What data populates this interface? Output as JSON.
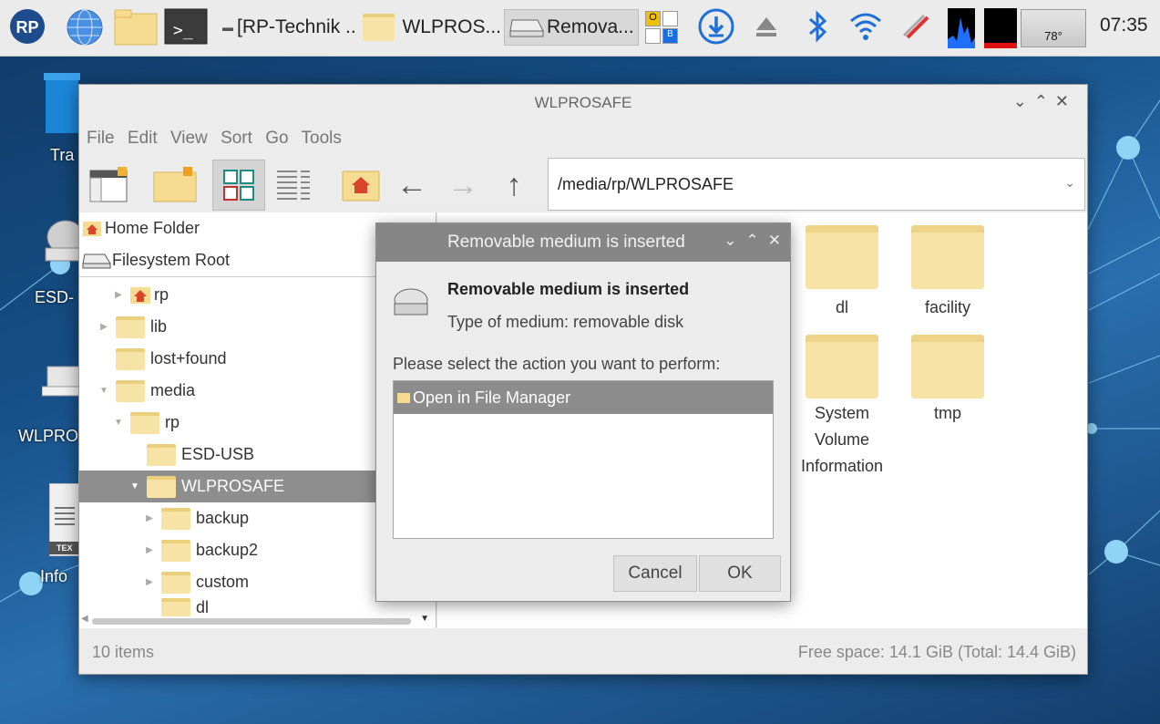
{
  "taskbar": {
    "tasks": [
      {
        "label": "[RP-Technik ..."
      },
      {
        "label": "WLPROS..."
      },
      {
        "label": "Remova..."
      }
    ],
    "temperature": "78°",
    "clock": "07:35",
    "keyboard_badges": [
      "O",
      "B"
    ]
  },
  "desktop": {
    "labels": [
      "Tra",
      "ESD-",
      "WLPRO",
      "Info"
    ],
    "doc_badge": "TEX"
  },
  "file_manager": {
    "title": "WLPROSAFE",
    "menu": [
      "File",
      "Edit",
      "View",
      "Sort",
      "Go",
      "Tools"
    ],
    "path": "/media/rp/WLPROSAFE",
    "places": [
      {
        "label": "Home Folder"
      },
      {
        "label": "Filesystem Root"
      }
    ],
    "tree": [
      {
        "label": "rp"
      },
      {
        "label": "lib"
      },
      {
        "label": "lost+found"
      },
      {
        "label": "media"
      },
      {
        "label": "rp"
      },
      {
        "label": "ESD-USB"
      },
      {
        "label": "WLPROSAFE"
      },
      {
        "label": "backup"
      },
      {
        "label": "backup2"
      },
      {
        "label": "custom"
      },
      {
        "label": "dl"
      }
    ],
    "files": [
      {
        "name": "dl"
      },
      {
        "name": "facility"
      },
      {
        "name": "System Volume Information"
      },
      {
        "name": "tmp"
      }
    ],
    "status_left": "10 items",
    "status_right": "Free space: 14.1 GiB (Total: 14.4 GiB)"
  },
  "dialog": {
    "title": "Removable medium is inserted",
    "heading": "Removable medium is inserted",
    "type_line": "Type of medium:  removable disk",
    "prompt": "Please select the action you want to perform:",
    "actions": [
      {
        "label": "Open in File Manager"
      }
    ],
    "cancel_label": "Cancel",
    "ok_label": "OK"
  }
}
